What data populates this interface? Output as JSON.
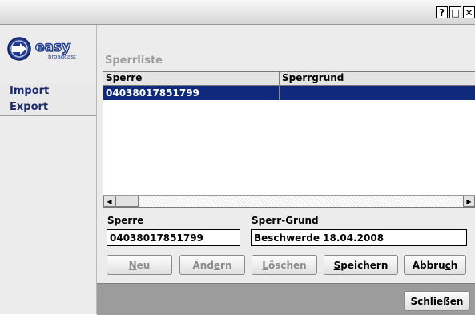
{
  "window": {
    "help_glyph": "?",
    "maximize_glyph": "□",
    "close_glyph": "✕"
  },
  "sidebar": {
    "logo_text": "easy",
    "logo_subtext": "broadcast",
    "items": [
      {
        "label_u": "I",
        "label_rest": "mport"
      },
      {
        "label_u": "",
        "label_rest": "Export"
      }
    ]
  },
  "main": {
    "section_title": "Sperrliste",
    "table": {
      "columns": [
        "Sperre",
        "Sperrgrund"
      ],
      "rows": [
        {
          "sperre": "04038017851799",
          "sperrgrund": ""
        }
      ]
    },
    "form": {
      "sperre_label": "Sperre",
      "sperre_value": "04038017851799",
      "grund_label": "Sperr-Grund",
      "grund_value": "Beschwerde 18.04.2008"
    },
    "buttons": {
      "neu": {
        "u": "N",
        "rest": "eu"
      },
      "aendern": {
        "pre": "Änd",
        "u": "e",
        "post": "rn"
      },
      "loeschen": {
        "u": "L",
        "rest": "öschen"
      },
      "speichern": {
        "u": "S",
        "rest": "peichern"
      },
      "abbruch": {
        "pre": "Abbru",
        "u": "c",
        "post": "h"
      }
    }
  },
  "footer": {
    "close_label": "Schließen"
  },
  "colors": {
    "selection": "#0f2a7a",
    "nav_text": "#1a2a6c",
    "logo_blue": "#1f3a8f"
  }
}
